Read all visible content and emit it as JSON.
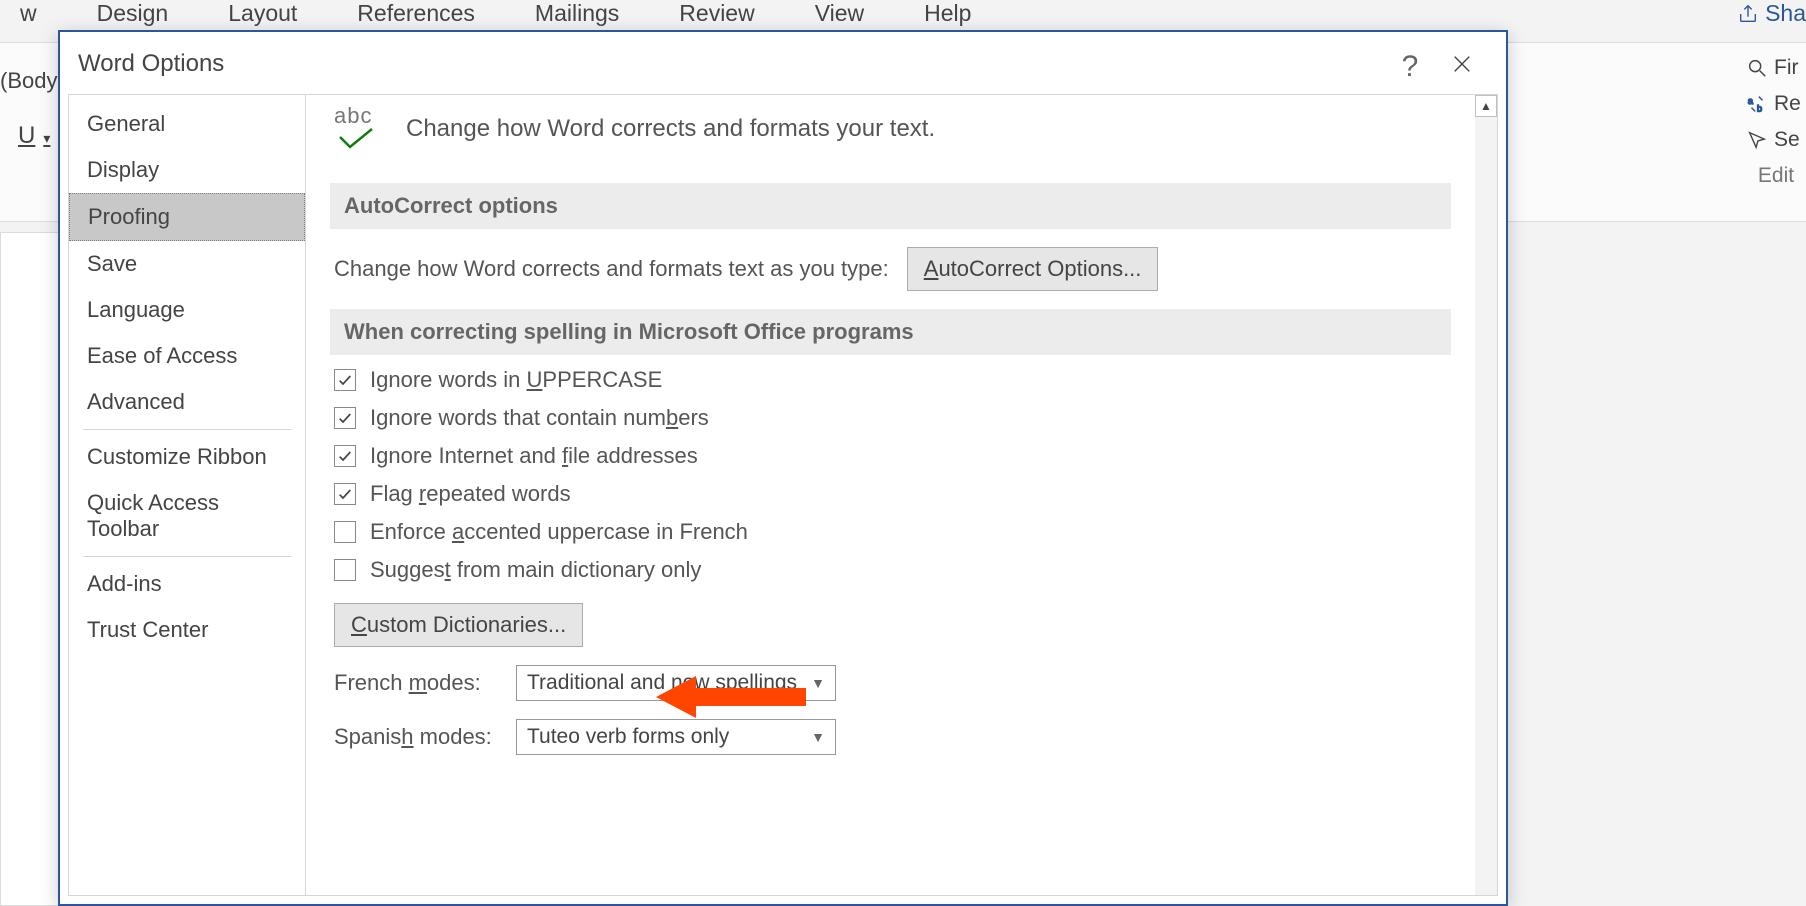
{
  "ribbon": {
    "tabs": [
      "w",
      "Design",
      "Layout",
      "References",
      "Mailings",
      "Review",
      "View",
      "Help"
    ],
    "share_label": "Sha"
  },
  "home_strip": {
    "font_label": "(Body)",
    "underline_btn": "U"
  },
  "editing_group": {
    "find": "Fir",
    "replace": "Re",
    "select": "Se",
    "group_label": "Edit"
  },
  "dialog": {
    "title": "Word Options",
    "help": "?",
    "nav": [
      "General",
      "Display",
      "Proofing",
      "Save",
      "Language",
      "Ease of Access",
      "Advanced",
      "Customize Ribbon",
      "Quick Access Toolbar",
      "Add-ins",
      "Trust Center"
    ],
    "selected_nav_index": 2,
    "header_text": "Change how Word corrects and formats your text.",
    "section1": "AutoCorrect options",
    "autocorrect_row_text": "Change how Word corrects and formats text as you type:",
    "autocorrect_button": "AutoCorrect Options...",
    "section2": "When correcting spelling in Microsoft Office programs",
    "checks": [
      {
        "checked": true,
        "pre": "Ignore words in ",
        "u": "U",
        "post": "PPERCASE"
      },
      {
        "checked": true,
        "pre": "Ignore words that contain num",
        "u": "b",
        "post": "ers"
      },
      {
        "checked": true,
        "pre": "Ignore Internet and ",
        "u": "f",
        "post": "ile addresses"
      },
      {
        "checked": true,
        "pre": "Flag ",
        "u": "r",
        "post": "epeated words"
      },
      {
        "checked": false,
        "pre": "Enforce ",
        "u": "a",
        "post": "ccented uppercase in French"
      },
      {
        "checked": false,
        "pre": "Sugges",
        "u": "t",
        "post": " from main dictionary only"
      }
    ],
    "custom_dict_btn": "Custom Dictionaries...",
    "french_label": "French modes:",
    "french_value": "Traditional and new spellings",
    "spanish_label": "Spanish modes:",
    "spanish_value": "Tuteo verb forms only"
  }
}
